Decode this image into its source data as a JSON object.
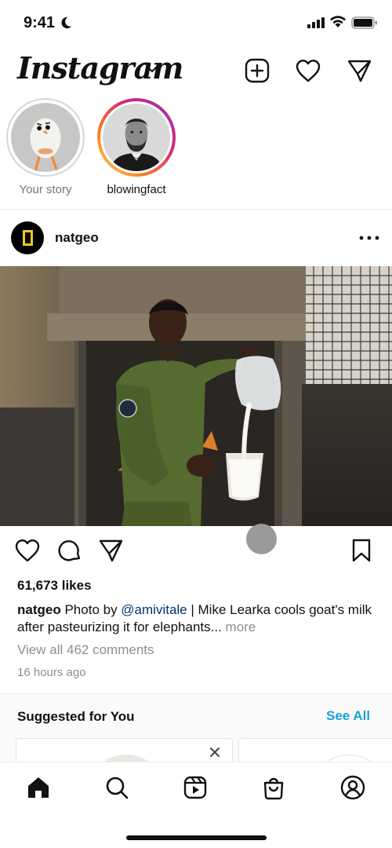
{
  "status": {
    "time": "9:41"
  },
  "header": {
    "brand": "Instagram",
    "icons": [
      "new-post-icon",
      "heart-icon",
      "direct-message-icon"
    ]
  },
  "stories": [
    {
      "label": "Your story",
      "avatar": "egg-character"
    },
    {
      "label": "blowingfact",
      "avatar": "lincoln-portrait"
    }
  ],
  "post": {
    "username": "natgeo",
    "likes": "61,673 likes",
    "caption": {
      "user": "natgeo",
      "text_before": "Photo by ",
      "mention": "@amivitale",
      "text_after": " | Mike Learka cools goat's milk after pasteurizing it for elephants...",
      "more": "more"
    },
    "view_comments": "View all 462 comments",
    "time_ago": "16 hours ago"
  },
  "suggested": {
    "title": "Suggested for You",
    "see_all": "See All"
  },
  "tabbar": [
    "home-icon",
    "search-icon",
    "reels-icon",
    "shop-icon",
    "profile-icon"
  ],
  "colors": {
    "story_ring": [
      "#feda75",
      "#fa7e1e",
      "#d62976",
      "#962fbf"
    ],
    "link": "#1aa1d9",
    "natgeo_yellow": "#f5c518"
  }
}
